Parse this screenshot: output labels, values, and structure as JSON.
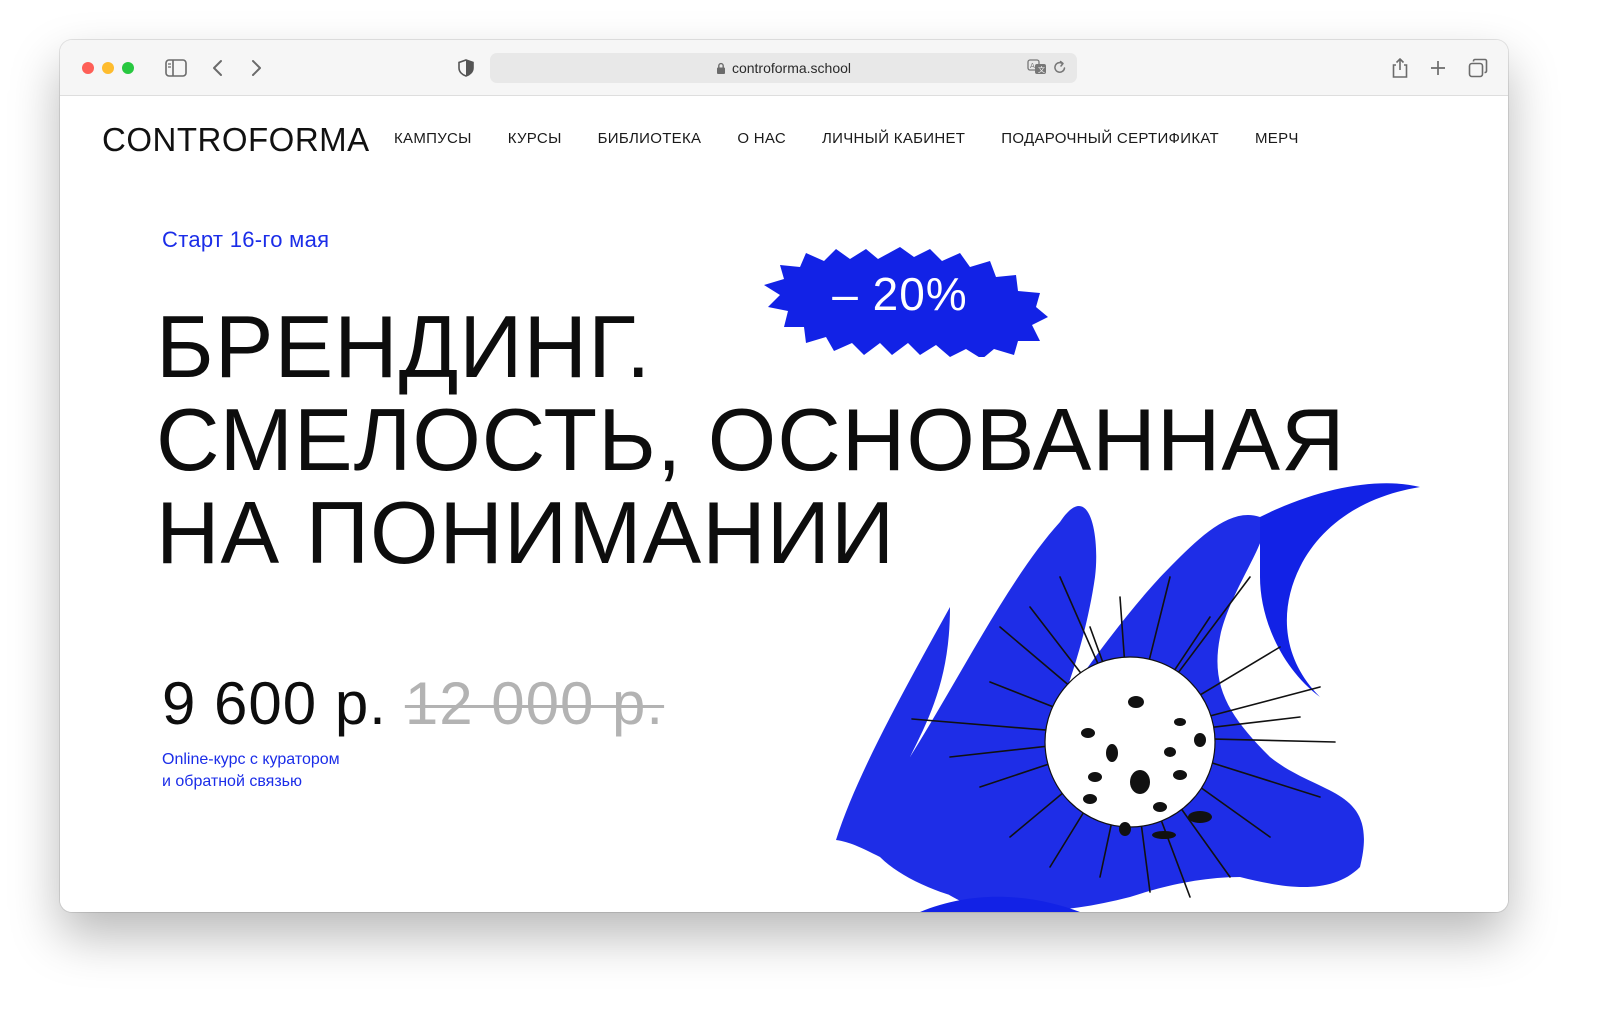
{
  "browser": {
    "url": "controforma.school"
  },
  "header": {
    "logo": "CONTROFORMA",
    "nav": [
      {
        "label": "КАМПУСЫ"
      },
      {
        "label": "КУРСЫ"
      },
      {
        "label": "БИБЛИОТЕКА"
      },
      {
        "label": "О НАС"
      },
      {
        "label": "ЛИЧНЫЙ КАБИНЕТ"
      },
      {
        "label": "ПОДАРОЧНЫЙ СЕРТИФИКАТ"
      },
      {
        "label": "МЕРЧ"
      }
    ]
  },
  "hero": {
    "start_date": "Старт 16-го мая",
    "discount_badge": "– 20%",
    "headline_lines": [
      "БРЕНДИНГ.",
      "СМЕЛОСТЬ, ОСНОВАННАЯ",
      "НА ПОНИМАНИИ"
    ],
    "price_new": "9 600 р.",
    "price_old": "12 000 р.",
    "description_lines": [
      "Online-курс с куратором",
      "и обратной связью"
    ]
  },
  "colors": {
    "accent": "#1b2de8",
    "text": "#0d0d0d",
    "old_price": "#b3b3b3"
  },
  "icons": [
    "sidebar-icon",
    "back-icon",
    "forward-icon",
    "shield-icon",
    "lock-icon",
    "translate-icon",
    "reload-icon",
    "share-icon",
    "new-tab-icon",
    "tabs-overview-icon"
  ]
}
